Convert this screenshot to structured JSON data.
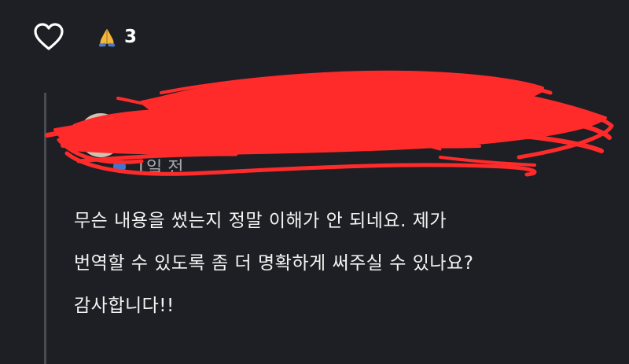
{
  "actions": {
    "like_icon": "heart-outline-icon",
    "reaction_icon": "folded-hands-emoji",
    "reaction_count": "3"
  },
  "reply": {
    "author_name": "",
    "meta_text": "1일 전",
    "redacted": true,
    "redaction_color": "#ff2b2b",
    "avatar_color": "#cfc4b2"
  },
  "comment": {
    "lines": [
      "무슨 내용을 썼는지 정말 이해가 안 되네요. 제가",
      "번역할 수 있도록 좀 더 명확하게 써주실 수 있나요?",
      "감사합니다!!"
    ]
  },
  "colors": {
    "background": "#1e1f24",
    "text": "#f4f4f4",
    "thread_line": "#4a4c52",
    "scribble": "#ff2b2b"
  }
}
